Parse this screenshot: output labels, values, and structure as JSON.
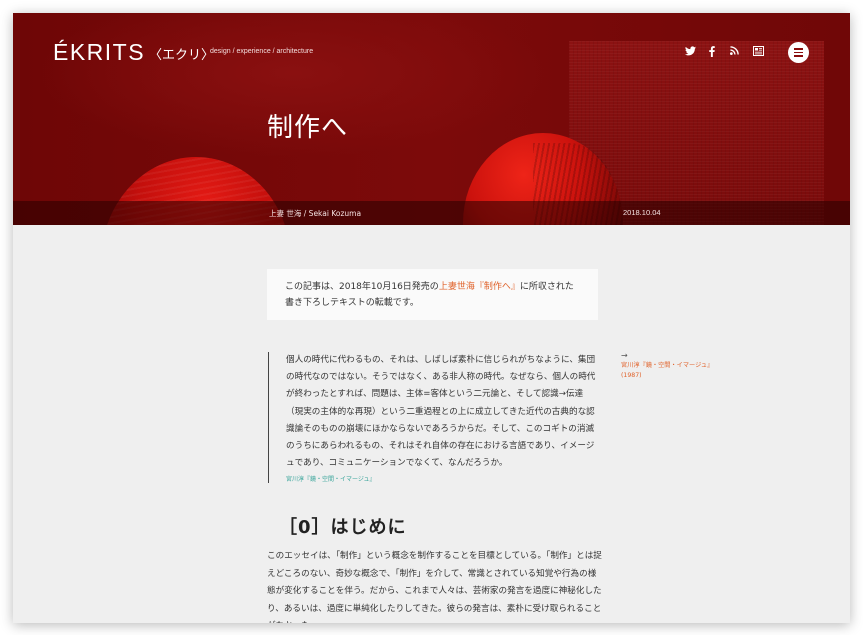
{
  "header": {
    "logo": "ÉKRITS",
    "logo_sub": "〈エクリ〉",
    "tagline": "design / experience / architecture",
    "social": [
      "twitter-icon",
      "facebook-icon",
      "rss-icon",
      "newsletter-icon"
    ],
    "menu_icon": "hamburger-icon"
  },
  "hero": {
    "title": "制作へ",
    "author": "上妻 世海 / Sekai Kozuma",
    "date": "2018.10.04"
  },
  "notice": {
    "before": "この記事は、2018年10月16日発売の",
    "link": "上妻世海『制作へ』",
    "after": "に所収された書き下ろしテキストの転載です。"
  },
  "quote": {
    "text": "個人の時代に代わるもの、それは、しばしば素朴に信じられがちなように、集団の時代なのではない。そうではなく、ある非人称の時代。なぜなら、個人の時代が終わったとすれば、問題は、主体=客体という二元論と、そして認識→伝達（現実の主体的な再現）という二重過程との上に成立してきた近代の古典的な認識論そのものの崩壊にほかならないであろうからだ。そして、このコギトの消滅のうちにあらわれるもの、それはそれ自体の存在における言語であり、イメージュであり、コミュニケーションでなくて、なんだろうか。",
    "cite": "宮川淳『鏡・空間・イマージュ』"
  },
  "sidenote": {
    "arrow": "→",
    "source": "宮川淳『鏡・空間・イマージュ』",
    "year": "(1987)"
  },
  "section": {
    "heading": "［0］はじめに",
    "body": "このエッセイは、「制作」という概念を制作することを目標としている。「制作」とは捉えどころのない、奇妙な概念で、「制作」を介して、常識とされている知覚や行為の様態が変化することを伴う。だから、これまで人々は、芸術家の発言を過度に神秘化したり、あるいは、過度に単純化したりしてきた。彼らの発言は、素朴に受け取られることがなかった。"
  },
  "colors": {
    "hero_red": "#7c0a0a",
    "link_orange": "#e0622a",
    "cite_teal": "#3aa59b"
  }
}
